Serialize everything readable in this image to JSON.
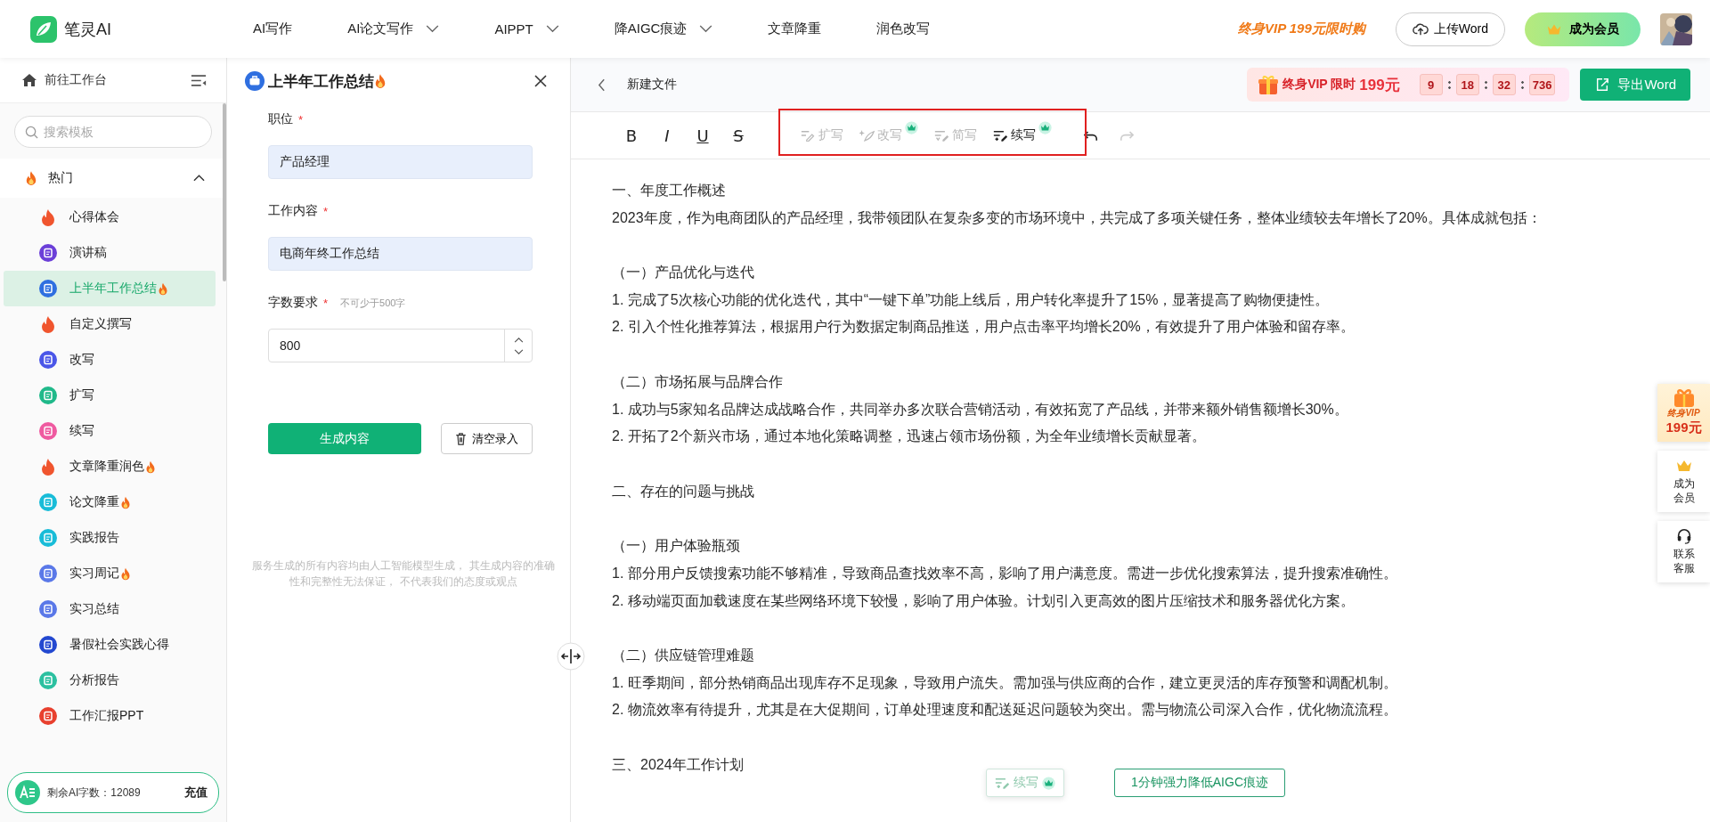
{
  "topbar": {
    "brand": "笔灵AI",
    "nav": [
      {
        "label": "AI写作",
        "dropdown": false
      },
      {
        "label": "AI论文写作",
        "dropdown": true
      },
      {
        "label": "AIPPT",
        "dropdown": true
      },
      {
        "label": "降AIGC痕迹",
        "dropdown": true
      },
      {
        "label": "文章降重",
        "dropdown": false
      },
      {
        "label": "润色改写",
        "dropdown": false
      }
    ],
    "promo": "终身VIP 199元限时购",
    "upload_button": "上传Word",
    "member_button": "成为会员"
  },
  "sidebar": {
    "workspace_link": "前往工作台",
    "search_placeholder": "搜索模板",
    "group": {
      "label": "热门",
      "expanded": true,
      "items": [
        {
          "label": "心得体会",
          "kind": "flame",
          "color": "#f0552e",
          "hot": false,
          "selected": false
        },
        {
          "label": "演讲稿",
          "kind": "badge",
          "color": "#6b3fd8",
          "hot": false,
          "selected": false
        },
        {
          "label": "上半年工作总结",
          "kind": "badge",
          "color": "#2f6fe0",
          "hot": true,
          "selected": true
        },
        {
          "label": "自定义撰写",
          "kind": "flame",
          "color": "#f0552e",
          "hot": false,
          "selected": false
        },
        {
          "label": "改写",
          "kind": "badge",
          "color": "#4a56e8",
          "hot": false,
          "selected": false
        },
        {
          "label": "扩写",
          "kind": "badge",
          "color": "#20b98a",
          "hot": false,
          "selected": false
        },
        {
          "label": "续写",
          "kind": "badge",
          "color": "#ef5aa0",
          "hot": false,
          "selected": false
        },
        {
          "label": "文章降重润色",
          "kind": "flame",
          "color": "#f0552e",
          "hot": true,
          "selected": false
        },
        {
          "label": "论文降重",
          "kind": "badge",
          "color": "#18bcd8",
          "hot": true,
          "selected": false
        },
        {
          "label": "实践报告",
          "kind": "badge",
          "color": "#18bcd8",
          "hot": false,
          "selected": false
        },
        {
          "label": "实习周记",
          "kind": "badge",
          "color": "#5a78e8",
          "hot": true,
          "selected": false
        },
        {
          "label": "实习总结",
          "kind": "badge",
          "color": "#5a78e8",
          "hot": false,
          "selected": false
        },
        {
          "label": "暑假社会实践心得",
          "kind": "badge",
          "color": "#2348d0",
          "hot": false,
          "selected": false
        },
        {
          "label": "分析报告",
          "kind": "badge",
          "color": "#2bc0a0",
          "hot": false,
          "selected": false
        },
        {
          "label": "工作汇报PPT",
          "kind": "badge",
          "color": "#e8402e",
          "hot": false,
          "selected": false
        }
      ]
    },
    "quota": {
      "label": "剩余AI字数：12089",
      "action": "充值"
    }
  },
  "form": {
    "title": "上半年工作总结",
    "hot": true,
    "fields": [
      {
        "label": "职位",
        "required_mark": "*",
        "kind": "text",
        "value": "产品经理"
      },
      {
        "label": "工作内容",
        "required_mark": "*",
        "kind": "text",
        "value": "电商年终工作总结"
      },
      {
        "label": "字数要求",
        "required_mark": "*",
        "kind": "number",
        "hint": "不可少于500字",
        "value": "800"
      }
    ],
    "generate_button": "生成内容",
    "clear_button": "清空录入",
    "disclaimer": "服务生成的所有内容均由人工智能模型生成， 其生成内容的准确性和完整性无法保证， 不代表我们的态度或观点"
  },
  "editor": {
    "file_name": "新建文件",
    "promo": {
      "label": "终身VIP 限时",
      "price": "199元",
      "countdown": [
        "9",
        "18",
        "32",
        "736"
      ]
    },
    "export_button": "导出Word",
    "format_buttons": [
      {
        "label": "B",
        "kind": "bold"
      },
      {
        "label": "I",
        "kind": "italic"
      },
      {
        "label": "U",
        "kind": "underline"
      },
      {
        "label": "S",
        "kind": "strike"
      }
    ],
    "ai_tools": [
      {
        "label": "扩写",
        "kind": "expand",
        "disabled": true,
        "premium": false
      },
      {
        "label": "改写",
        "kind": "rewrite",
        "disabled": true,
        "premium": true
      },
      {
        "label": "简写",
        "kind": "shorten",
        "disabled": true,
        "premium": false
      },
      {
        "label": "续写",
        "kind": "continue",
        "disabled": false,
        "premium": true
      }
    ],
    "history": [
      {
        "kind": "undo",
        "disabled": false
      },
      {
        "kind": "redo",
        "disabled": true
      }
    ],
    "document": [
      [
        "一、年度工作概述",
        "2023年度，作为电商团队的产品经理，我带领团队在复杂多变的市场环境中，共完成了多项关键任务，整体业绩较去年增长了20%。具体成就包括："
      ],
      [
        "（一）产品优化与迭代",
        "1. 完成了5次核心功能的优化迭代，其中“一键下单”功能上线后，用户转化率提升了15%，显著提高了购物便捷性。",
        "2. 引入个性化推荐算法，根据用户行为数据定制商品推送，用户点击率平均增长20%，有效提升了用户体验和留存率。"
      ],
      [
        "（二）市场拓展与品牌合作",
        "1. 成功与5家知名品牌达成战略合作，共同举办多次联合营销活动，有效拓宽了产品线，并带来额外销售额增长30%。",
        "2. 开拓了2个新兴市场，通过本地化策略调整，迅速占领市场份额，为全年业绩增长贡献显著。"
      ],
      [
        "二、存在的问题与挑战"
      ],
      [
        "（一）用户体验瓶颈",
        "1. 部分用户反馈搜索功能不够精准，导致商品查找效率不高，影响了用户满意度。需进一步优化搜索算法，提升搜索准确性。",
        "2. 移动端页面加载速度在某些网络环境下较慢，影响了用户体验。计划引入更高效的图片压缩技术和服务器优化方案。"
      ],
      [
        "（二）供应链管理难题",
        "1. 旺季期间，部分热销商品出现库存不足现象，导致用户流失。需加强与供应商的合作，建立更灵活的库存预警和调配机制。",
        "2. 物流效率有待提升，尤其是在大促期间，订单处理速度和配送延迟问题较为突出。需与物流公司深入合作，优化物流流程。"
      ],
      [
        "三、2024年工作计划"
      ]
    ],
    "floating_actions": [
      {
        "label": "续写",
        "kind": "continue",
        "premium": true
      },
      {
        "label": "1分钟强力降低AIGC痕迹",
        "kind": "aigc"
      }
    ]
  },
  "side_widgets": [
    {
      "kind": "vip",
      "label": "终身VIP",
      "price": "199元"
    },
    {
      "kind": "member",
      "label": "成为会员"
    },
    {
      "kind": "service",
      "label": "联系客服"
    }
  ]
}
